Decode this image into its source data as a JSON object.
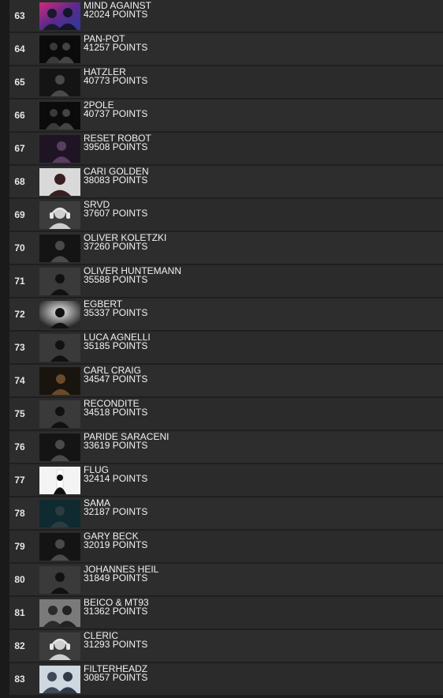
{
  "rows": [
    {
      "rank": "63",
      "name": "MIND AGAINST",
      "points": "42024 POINTS",
      "thumb": "duo-pink"
    },
    {
      "rank": "64",
      "name": "PAN-POT",
      "points": "41257 POINTS",
      "thumb": "duo-dark"
    },
    {
      "rank": "65",
      "name": "HATZLER",
      "points": "40773 POINTS",
      "thumb": "solo-dark"
    },
    {
      "rank": "66",
      "name": "2POLE",
      "points": "40737 POINTS",
      "thumb": "duo-dark"
    },
    {
      "rank": "67",
      "name": "RESET ROBOT",
      "points": "39508 POINTS",
      "thumb": "solo-purple"
    },
    {
      "rank": "68",
      "name": "CARI GOLDEN",
      "points": "38083 POINTS",
      "thumb": "solo-light"
    },
    {
      "rank": "69",
      "name": "SRVD",
      "points": "37607 POINTS",
      "thumb": "placeholder"
    },
    {
      "rank": "70",
      "name": "OLIVER KOLETZKI",
      "points": "37260 POINTS",
      "thumb": "solo-dark"
    },
    {
      "rank": "71",
      "name": "OLIVER HUNTEMANN",
      "points": "35588 POINTS",
      "thumb": "solo-grey"
    },
    {
      "rank": "72",
      "name": "EGBERT",
      "points": "35337 POINTS",
      "thumb": "solo-spot"
    },
    {
      "rank": "73",
      "name": "LUCA AGNELLI",
      "points": "35185 POINTS",
      "thumb": "solo-grey"
    },
    {
      "rank": "74",
      "name": "CARL CRAIG",
      "points": "34547 POINTS",
      "thumb": "solo-warm"
    },
    {
      "rank": "75",
      "name": "RECONDITE",
      "points": "34518 POINTS",
      "thumb": "solo-grey"
    },
    {
      "rank": "76",
      "name": "PARIDE SARACENI",
      "points": "33619 POINTS",
      "thumb": "solo-dark"
    },
    {
      "rank": "77",
      "name": "FLUG",
      "points": "32414 POINTS",
      "thumb": "silhouette-white"
    },
    {
      "rank": "78",
      "name": "SAMA",
      "points": "32187 POINTS",
      "thumb": "solo-teal"
    },
    {
      "rank": "79",
      "name": "GARY BECK",
      "points": "32019 POINTS",
      "thumb": "solo-dark"
    },
    {
      "rank": "80",
      "name": "JOHANNES HEIL",
      "points": "31849 POINTS",
      "thumb": "solo-grey"
    },
    {
      "rank": "81",
      "name": "BEICO & MT93",
      "points": "31362 POINTS",
      "thumb": "duo-light"
    },
    {
      "rank": "82",
      "name": "CLERIC",
      "points": "31293 POINTS",
      "thumb": "placeholder"
    },
    {
      "rank": "83",
      "name": "FILTERHEADZ",
      "points": "30857 POINTS",
      "thumb": "duo-bright"
    }
  ]
}
